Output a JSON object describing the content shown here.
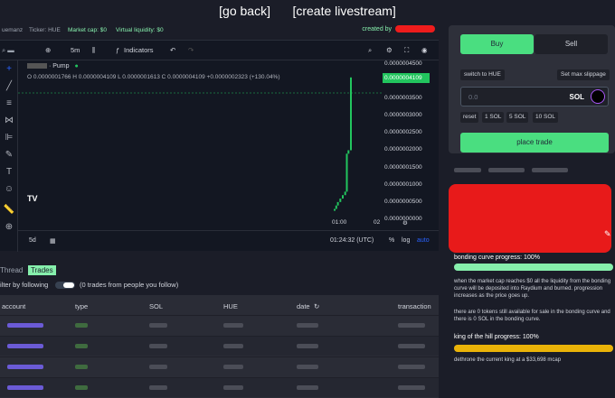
{
  "topnav": {
    "go_back": "[go back]",
    "create_livestream": "[create livestream]"
  },
  "token": {
    "ticker": "Ticker: HUE",
    "market_cap": "Market cap: $0",
    "virtual_liquidity": "Virtual liquidity: $0",
    "created_by": "created by",
    "creator_prefix": "uemanz"
  },
  "chart_toolbar": {
    "interval": "5m",
    "indicators": "Indicators"
  },
  "chart_legend": {
    "title": "· Pump",
    "ohlc": "O 0.0000001766 H 0.0000004109 L 0.0000001613 C 0.0000004109 +0.0000002323 (+130.04%)"
  },
  "chart_data": {
    "type": "line",
    "y_ticks": [
      "0.0000004500",
      "0.0000004109",
      "0.0000003500",
      "0.0000003000",
      "0.0000002500",
      "0.0000002000",
      "0.0000001500",
      "0.0000001000",
      "0.0000000500",
      "0.0000000000"
    ],
    "x_ticks": [
      "01:00",
      "02"
    ],
    "current_price": "0.0000004109",
    "points": [
      {
        "x": 0.0,
        "y": 3e-08
      },
      {
        "x": 0.1,
        "y": 4e-08
      },
      {
        "x": 0.2,
        "y": 5e-08
      },
      {
        "x": 0.35,
        "y": 6e-08
      },
      {
        "x": 0.5,
        "y": 7e-08
      },
      {
        "x": 0.65,
        "y": 8e-08
      },
      {
        "x": 0.75,
        "y": 1.9e-07
      },
      {
        "x": 0.85,
        "y": 2e-07
      },
      {
        "x": 1.0,
        "y": 4.109e-07
      }
    ]
  },
  "chart_bottom": {
    "range": "5d",
    "time": "01:24:32 (UTC)",
    "pct": "%",
    "log": "log",
    "auto": "auto"
  },
  "tabs": {
    "thread": "Thread",
    "trades": "Trades"
  },
  "filter": {
    "label": "ilter by following",
    "note": "(0 trades from people you follow)"
  },
  "table": {
    "headers": [
      "account",
      "type",
      "SOL",
      "HUE",
      "date",
      "transaction"
    ],
    "rows": [
      0,
      1,
      2,
      3
    ]
  },
  "trade": {
    "buy": "Buy",
    "sell": "Sell",
    "switch_to": "switch to HUE",
    "slippage": "Set max slippage",
    "amount_placeholder": "0.0",
    "unit": "SOL",
    "quick": [
      "reset",
      "1 SOL",
      "5 SOL",
      "10 SOL"
    ],
    "place_trade": "place trade"
  },
  "progress": {
    "bonding_label": "bonding curve progress: 100%",
    "bonding_value": 1.0,
    "bonding_desc": "when the market cap reaches $0 all the liquidity from the bonding curve will be deposited into Raydium and burned. progression increases as the price goes up.",
    "tokens_desc": "there are 0 tokens still available for sale in the bonding curve and there is 0 SOL in the bonding curve.",
    "koth_label": "king of the hill progress: 100%",
    "koth_value": 1.0,
    "koth_desc": "dethrone the current king at a $33,698 mcap"
  },
  "colors": {
    "accent": "#4ade80",
    "bonding_bar": "#86efac",
    "koth_bar": "#eab308",
    "redact": "#e81a1a"
  }
}
